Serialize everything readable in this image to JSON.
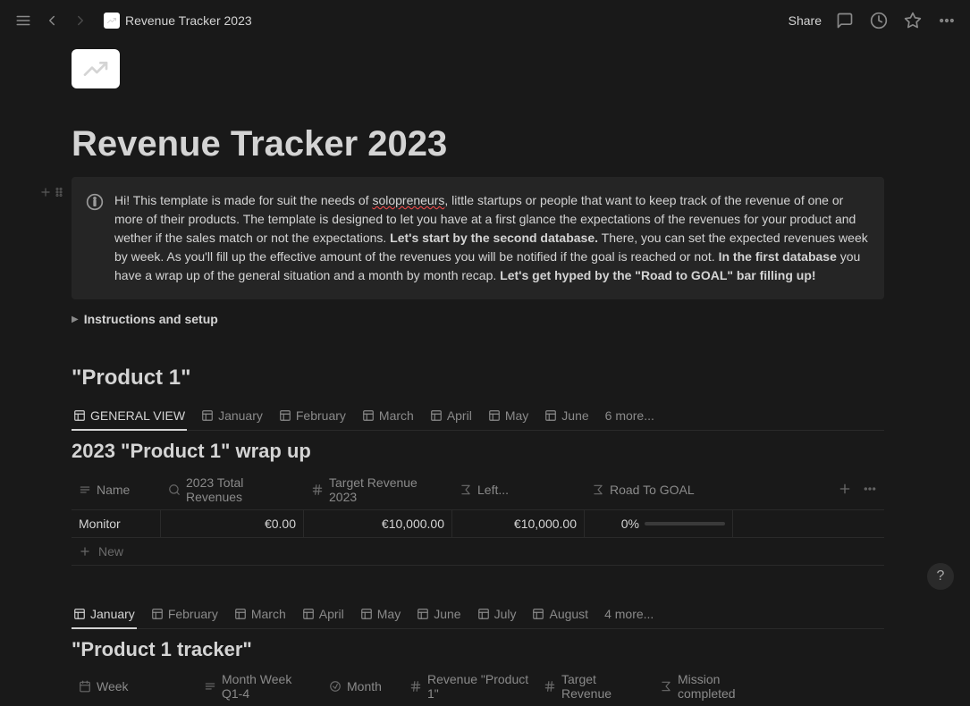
{
  "topbar": {
    "breadcrumb": "Revenue Tracker 2023",
    "share": "Share"
  },
  "page": {
    "title": "Revenue Tracker 2023"
  },
  "callout": {
    "p1": "Hi! This template is made for suit the needs of ",
    "p2": "solopreneurs",
    "p3": ", little startups or people that want to keep track of the revenue of one or more of their products. The template is designed to let you have at a first glance the expectations of the revenues for your product and wether if the sales match or not the expectations. ",
    "p4": "Let's start by the second database.",
    "p5": " There, you can set the expected revenues week by week. As you'll fill up the effective amount of the revenues you will be notified if the goal is reached or not. ",
    "p6": "In the first database",
    "p7": " you have a wrap up of the general situation and a month by month recap. ",
    "p8": "Let's get hyped by the \"Road to GOAL\" bar filling up!"
  },
  "toggle": {
    "label": "Instructions and setup"
  },
  "section1": {
    "heading": "\"Product 1\"",
    "tabs": [
      "GENERAL VIEW",
      "January",
      "February",
      "March",
      "April",
      "May",
      "June"
    ],
    "more": "6 more...",
    "view_title": "2023 \"Product 1\" wrap up",
    "columns": {
      "name": "Name",
      "total": "2023 Total Revenues",
      "target": "Target Revenue 2023",
      "left": "Left...",
      "road": "Road To GOAL"
    },
    "row": {
      "name": "Monitor",
      "total": "€0.00",
      "target": "€10,000.00",
      "left": "€10,000.00",
      "road": "0%"
    },
    "new": "New"
  },
  "section2": {
    "tabs": [
      "January",
      "February",
      "March",
      "April",
      "May",
      "June",
      "July",
      "August"
    ],
    "more": "4 more...",
    "heading": "\"Product 1 tracker\"",
    "columns": {
      "week": "Week",
      "month_week": "Month Week Q1-4",
      "month": "Month",
      "revenue": "Revenue \"Product 1\"",
      "target": "Target Revenue",
      "mission": "Mission completed"
    }
  },
  "help": "?"
}
